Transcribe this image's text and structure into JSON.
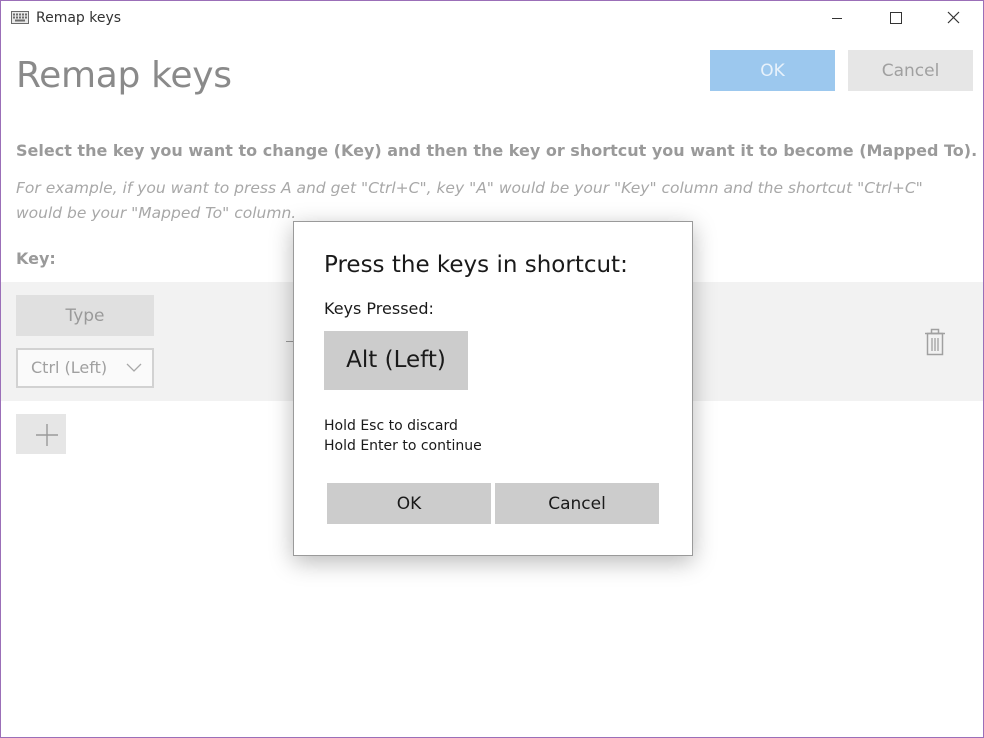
{
  "window": {
    "title": "Remap keys",
    "icon": "keyboard-icon",
    "controls": [
      "minimize-icon",
      "maximize-icon",
      "close-icon"
    ]
  },
  "header": {
    "title": "Remap keys",
    "ok_label": "OK",
    "cancel_label": "Cancel"
  },
  "instructions": {
    "main": "Select the key you want to change (Key) and then the key or shortcut you want it to become (Mapped To).",
    "example": "For example, if you want to press A and get \"Ctrl+C\", key \"A\" would be your \"Key\" column and the shortcut \"Ctrl+C\" would be your \"Mapped To\" column."
  },
  "mapping": {
    "key_label": "Key:",
    "type_button": "Type",
    "selected_key": "Ctrl (Left)",
    "delete_icon": "trash-icon",
    "add_icon": "plus-icon"
  },
  "dialog": {
    "title": "Press the keys in shortcut:",
    "keys_pressed_label": "Keys Pressed:",
    "pressed_key": "Alt (Left)",
    "hint_discard": "Hold Esc to discard",
    "hint_continue": "Hold Enter to continue",
    "ok_label": "OK",
    "cancel_label": "Cancel"
  },
  "colors": {
    "accent_disabled": "#9cc8ee",
    "window_border": "#9b6fb8"
  }
}
